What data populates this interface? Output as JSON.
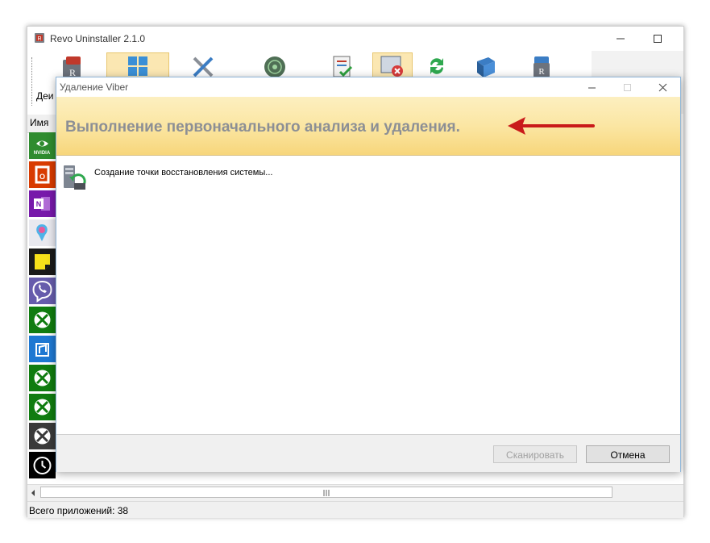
{
  "main_window": {
    "title": "Revo Uninstaller 2.1.0",
    "toolbar_uninstall_label": "Деи",
    "column_name": "Имя",
    "status_text": "Всего приложений: 38",
    "apps": [
      {
        "icon": "nvidia-icon",
        "label": "NVIDIA"
      },
      {
        "icon": "office-icon",
        "label": "O"
      },
      {
        "icon": "onenote-icon",
        "label": "N"
      },
      {
        "icon": "paint3d-icon"
      },
      {
        "icon": "sticky-notes-icon"
      },
      {
        "icon": "viber-icon"
      },
      {
        "icon": "xbox-icon"
      },
      {
        "icon": "groove-music-icon"
      },
      {
        "icon": "xbox-icon"
      },
      {
        "icon": "xbox-icon"
      },
      {
        "icon": "xbox-icon"
      },
      {
        "icon": "alarms-clock-icon"
      }
    ]
  },
  "dialog": {
    "title": "Удаление Viber",
    "heading": "Выполнение первоначального анализа и удаления.",
    "progress_text": "Создание точки восстановления системы...",
    "scan_label": "Сканировать",
    "cancel_label": "Отмена"
  },
  "colors": {
    "banner_top": "#fcefc0",
    "banner_bottom": "#f7d67b",
    "heading_text": "#8c8f95",
    "annotation_arrow": "#c91a1a"
  }
}
